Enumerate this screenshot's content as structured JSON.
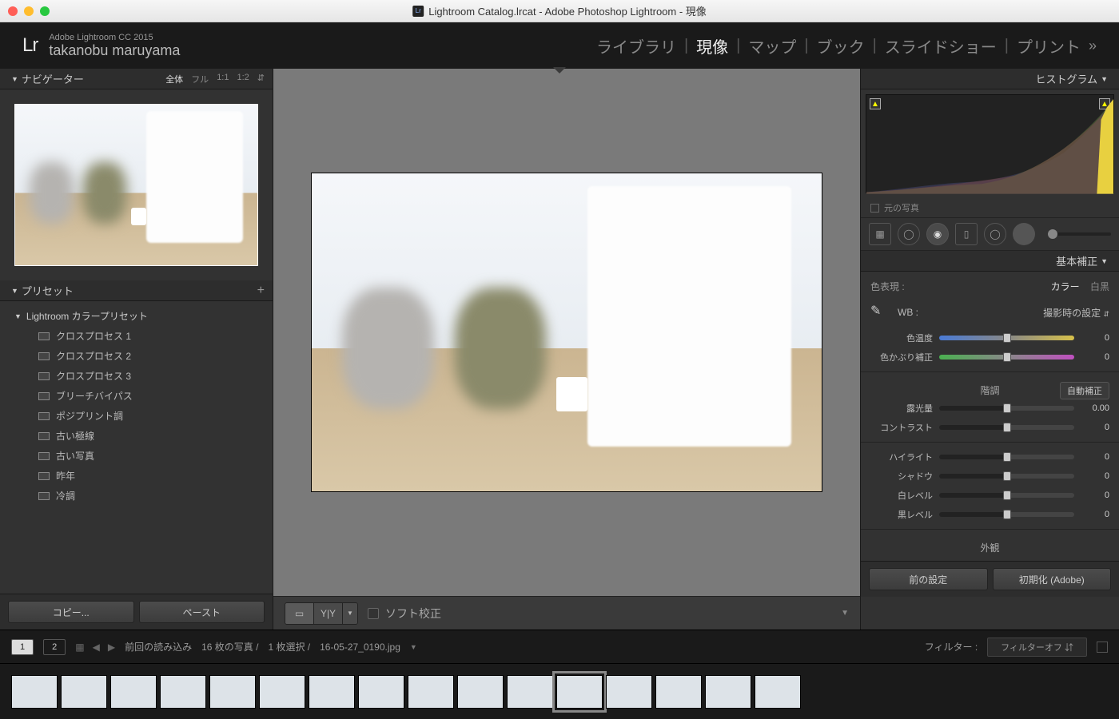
{
  "window": {
    "title": "Lightroom Catalog.lrcat - Adobe Photoshop Lightroom - 現像"
  },
  "identity": {
    "logo": "Lr",
    "product": "Adobe Lightroom CC 2015",
    "user": "takanobu maruyama"
  },
  "modules": {
    "items": [
      "ライブラリ",
      "現像",
      "マップ",
      "ブック",
      "スライドショー",
      "プリント"
    ],
    "active_index": 1,
    "more": "»"
  },
  "left": {
    "navigator": {
      "title": "ナビゲーター",
      "zoom": [
        "全体",
        "フル",
        "1:1",
        "1:2"
      ],
      "zoom_active": 0
    },
    "presets": {
      "title": "プリセット",
      "folder": "Lightroom カラープリセット",
      "items": [
        "クロスプロセス 1",
        "クロスプロセス 2",
        "クロスプロセス 3",
        "ブリーチバイパス",
        "ポジプリント調",
        "古い極線",
        "古い写真",
        "昨年",
        "冷調"
      ]
    },
    "buttons": {
      "copy": "コピー...",
      "paste": "ペースト"
    }
  },
  "center": {
    "toolbar": {
      "softproof": "ソフト校正"
    }
  },
  "right": {
    "histogram": {
      "title": "ヒストグラム",
      "original": "元の写真"
    },
    "basic": {
      "title": "基本補正",
      "treatment_label": "色表現 :",
      "treatment_opts": [
        "カラー",
        "白黒"
      ],
      "treatment_active": 0,
      "wb_label": "WB :",
      "wb_value": "撮影時の設定",
      "temp_label": "色温度",
      "temp_value": "0",
      "tint_label": "色かぶり補正",
      "tint_value": "0",
      "tone_title": "階調",
      "auto": "自動補正",
      "exposure_label": "露光量",
      "exposure_value": "0.00",
      "contrast_label": "コントラスト",
      "contrast_value": "0",
      "highlights_label": "ハイライト",
      "highlights_value": "0",
      "shadows_label": "シャドウ",
      "shadows_value": "0",
      "whites_label": "白レベル",
      "whites_value": "0",
      "blacks_label": "黒レベル",
      "blacks_value": "0",
      "presence_title": "外観"
    },
    "buttons": {
      "prev": "前の設定",
      "reset": "初期化 (Adobe)"
    }
  },
  "secondary": {
    "screens": [
      "1",
      "2"
    ],
    "source": "前回の読み込み",
    "count": "16 枚の写真 /",
    "selected": "1 枚選択 /",
    "filename": "16-05-27_0190.jpg",
    "filter_label": "フィルター :",
    "filter_value": "フィルターオフ"
  },
  "filmstrip": {
    "count": 16,
    "selected_index": 11
  }
}
